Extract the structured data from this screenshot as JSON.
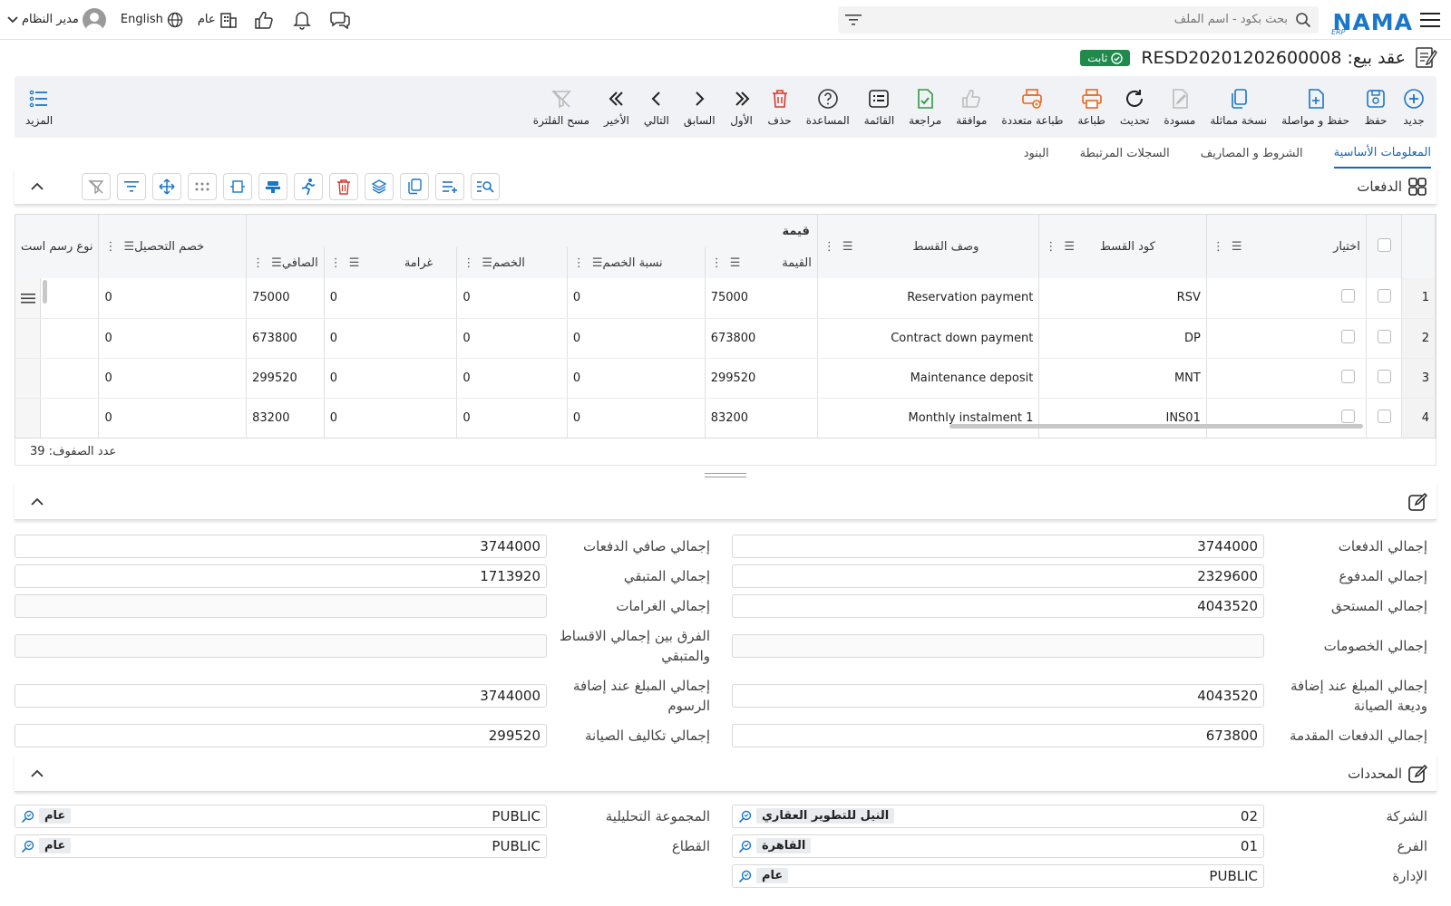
{
  "topbar": {
    "search_placeholder": "بحث بكود - اسم الملف",
    "user_name": "مدير النظام",
    "language": "English",
    "context": "عام",
    "logo_text": "NAMA",
    "logo_sub": "ERP"
  },
  "doc": {
    "title": "عقد بيع: RESD20201202600008",
    "status": "ثابت"
  },
  "toolbar": {
    "new": "جديد",
    "save": "حفظ",
    "save_continue": "حفظ و مواصلة",
    "duplicate": "نسخة مماثلة",
    "draft": "مسودة",
    "refresh": "تحديث",
    "print": "طباعة",
    "multi_print": "طباعة متعددة",
    "approve": "موافقة",
    "review": "مراجعة",
    "list": "القائمة",
    "help": "المساعدة",
    "delete": "حذف",
    "first": "الأول",
    "prev": "السابق",
    "next": "التالي",
    "last": "الأخير",
    "clear_filter": "مسح الفلترة",
    "more": "المزيد"
  },
  "tabs": [
    "المعلومات الأساسية",
    "الشروط و المصاريف",
    "السجلات المرتبطة",
    "البنود"
  ],
  "payments": {
    "title": "الدفعات",
    "headers": {
      "select": "اختيار",
      "code": "كود القسط",
      "desc": "وصف القسط",
      "value_group": "قيمة",
      "value": "القيمة",
      "discount_pct": "نسبة الخصم",
      "discount": "الخصم",
      "penalty": "غرامة",
      "net": "الصافي",
      "collection_discount": "خصم التحصيل",
      "fee_type": "نوع رسم است"
    },
    "rows": [
      {
        "idx": "1",
        "code": "RSV",
        "desc": "Reservation payment",
        "value": "75000",
        "discount_pct": "0",
        "discount": "0",
        "penalty": "0",
        "net": "75000",
        "collection_discount": "0"
      },
      {
        "idx": "2",
        "code": "DP",
        "desc": "Contract down payment",
        "value": "673800",
        "discount_pct": "0",
        "discount": "0",
        "penalty": "0",
        "net": "673800",
        "collection_discount": "0"
      },
      {
        "idx": "3",
        "code": "MNT",
        "desc": "Maintenance deposit",
        "value": "299520",
        "discount_pct": "0",
        "discount": "0",
        "penalty": "0",
        "net": "299520",
        "collection_discount": "0"
      },
      {
        "idx": "4",
        "code": "INS01",
        "desc": "Monthly instalment 1",
        "value": "83200",
        "discount_pct": "0",
        "discount": "0",
        "penalty": "0",
        "net": "83200",
        "collection_discount": "0"
      }
    ],
    "row_count_label": "عدد الصفوف: 39"
  },
  "totals": {
    "right": [
      {
        "label": "إجمالي الدفعات",
        "value": "3744000"
      },
      {
        "label": "إجمالي المدفوع",
        "value": "2329600"
      },
      {
        "label": "إجمالي المستحق",
        "value": "4043520"
      },
      {
        "label": "إجمالي الخصومات",
        "value": ""
      },
      {
        "label": "إجمالي المبلغ عند إضافة وديعة الصيانة",
        "value": "4043520"
      },
      {
        "label": "إجمالي الدفعات المقدمة",
        "value": "673800"
      }
    ],
    "left": [
      {
        "label": "إجمالي صافي الدفعات",
        "value": "3744000"
      },
      {
        "label": "إجمالي المتبقي",
        "value": "1713920"
      },
      {
        "label": "إجمالي الغرامات",
        "value": ""
      },
      {
        "label": "الفرق بين إجمالي الاقساط والمتبقي",
        "value": ""
      },
      {
        "label": "إجمالي المبلغ عند إضافة الرسوم",
        "value": "3744000"
      },
      {
        "label": "إجمالي تكاليف الصيانة",
        "value": "299520"
      }
    ]
  },
  "dimensions": {
    "title": "المحددات",
    "right": [
      {
        "label": "الشركة",
        "code": "02",
        "name": "النيل للتطوير العقاري"
      },
      {
        "label": "الفرع",
        "code": "01",
        "name": "القاهرة"
      },
      {
        "label": "الإدارة",
        "code": "PUBLIC",
        "name": "عام"
      }
    ],
    "left": [
      {
        "label": "المجموعة التحليلية",
        "code": "PUBLIC",
        "name": "عام"
      },
      {
        "label": "القطاع",
        "code": "PUBLIC",
        "name": "عام"
      }
    ]
  },
  "colors": {
    "accent": "#1a76c9",
    "status_green": "#1f8a4c",
    "print_orange": "#e8661a",
    "delete_red": "#d9362b",
    "review_green": "#2e9b3e"
  }
}
